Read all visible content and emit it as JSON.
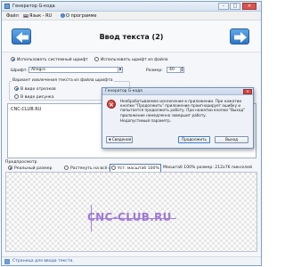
{
  "window": {
    "title": "Генератор G-кода",
    "controls": {
      "minimize": "–",
      "maximize": "□",
      "close": "✕"
    }
  },
  "menu": {
    "items": [
      "Файл",
      "Язык - RU",
      "О программе"
    ]
  },
  "header": {
    "title": "Ввод текста (2)",
    "back_icon": "arrow-left-icon",
    "forward_icon": "arrow-right-icon"
  },
  "font_source": {
    "system_label": "Использовать системный шрифт",
    "file_label": "Использовать шрифт из файла",
    "selected": "system"
  },
  "font_row": {
    "font_label": "Шрифт:",
    "font_value": "Allegro",
    "size_label": "Размер:",
    "size_value": "40"
  },
  "extract_group": {
    "title": "Вариант извлечения текста из файла шрифта",
    "options": [
      "В виде отрезков",
      "В виде рисунка"
    ],
    "selected": 0
  },
  "text_input": {
    "value": "CNC-CLUB.RU"
  },
  "preview": {
    "label": "Предпросмотр",
    "options": [
      "Реальный размер",
      "Растянуть на всё окно",
      "Уст. масштаб 100%"
    ],
    "scale_info": "Масштаб 100% размер: 212x76 пикселей",
    "render_text": "CNC-CLUB.RU"
  },
  "status": {
    "text": "Страница для ввода текста."
  },
  "dialog": {
    "title": "Генератор G-кода",
    "message": "Необрабатываемое исключение в приложении. При нажатии кнопки \"Продолжить\" приложение проигнорирует ошибку и попытается продолжить работу. При нажатии кнопки \"Выход\" приложение немедленно завершит работу.",
    "detail": "Недопустимый параметр.",
    "details_button": "Сведения",
    "continue_button": "Продолжить",
    "exit_button": "Выход",
    "close_glyph": "✕"
  },
  "colors": {
    "accent": "#2e74c4",
    "error": "#c0201a",
    "preview_text": "#9f78d8"
  }
}
